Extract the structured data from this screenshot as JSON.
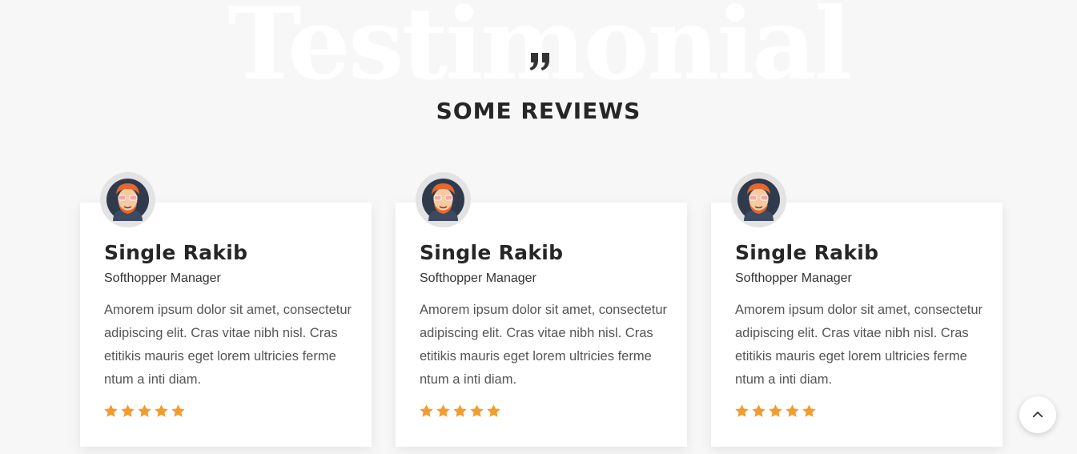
{
  "section": {
    "background_title": "Testimonial",
    "heading": "SOME REVIEWS",
    "quote_icon": "quote-icon"
  },
  "reviews": [
    {
      "name": "Single Rakib",
      "role": "Softhopper Manager",
      "text": "Amorem ipsum dolor sit amet, consectetur adipiscing elit. Cras vitae nibh nisl. Cras etitikis mauris eget lorem ultricies ferme ntum a inti diam.",
      "rating": 5
    },
    {
      "name": "Single Rakib",
      "role": "Softhopper Manager",
      "text": "Amorem ipsum dolor sit amet, consectetur adipiscing elit. Cras vitae nibh nisl. Cras etitikis mauris eget lorem ultricies ferme ntum a inti diam.",
      "rating": 5
    },
    {
      "name": "Single Rakib",
      "role": "Softhopper Manager",
      "text": "Amorem ipsum dolor sit amet, consectetur adipiscing elit. Cras vitae nibh nisl. Cras etitikis mauris eget lorem ultricies ferme ntum a inti diam.",
      "rating": 5
    }
  ],
  "colors": {
    "background": "#f7f7f7",
    "star": "#f39c2d",
    "heading": "#262626"
  },
  "scroll_top": {
    "icon": "chevron-up-icon"
  }
}
